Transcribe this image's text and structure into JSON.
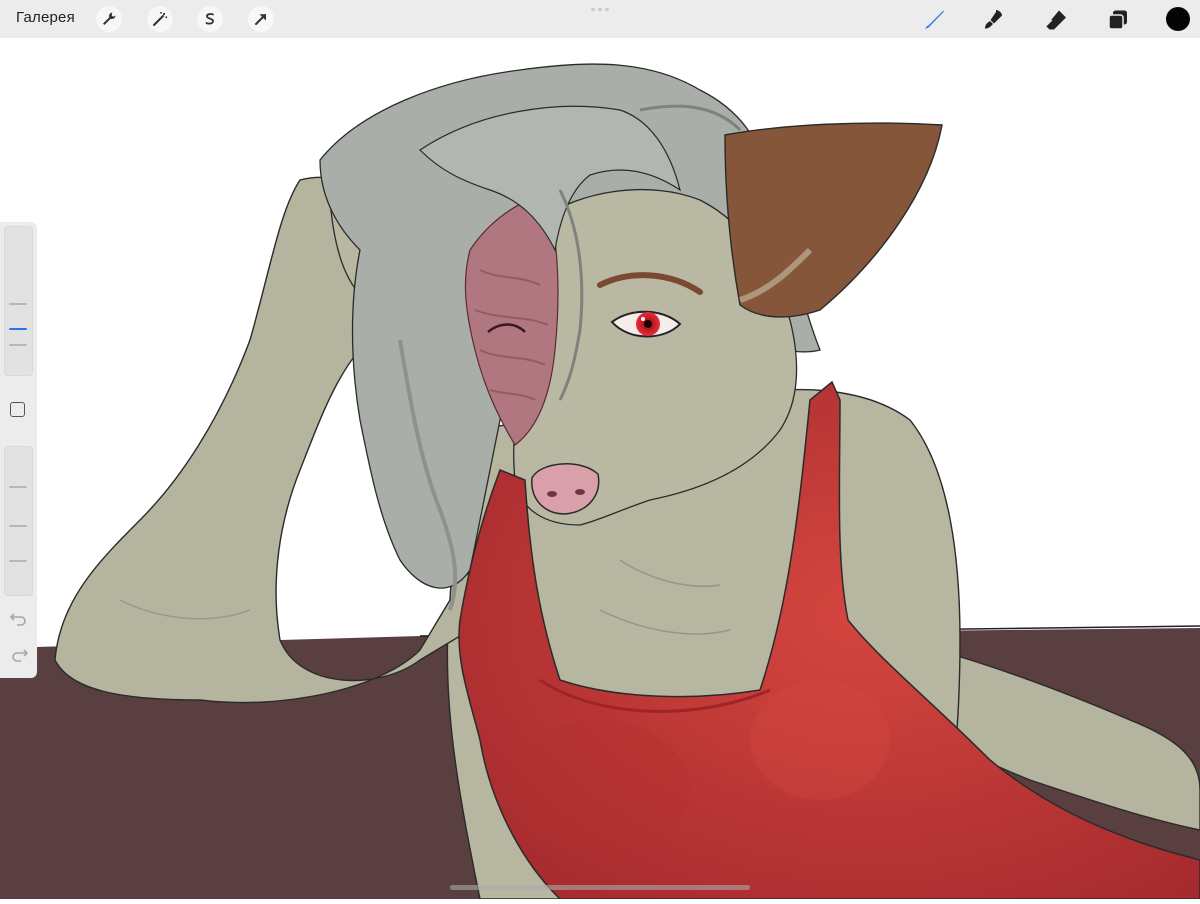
{
  "topbar": {
    "gallery_label": "Галерея",
    "left_tools": [
      {
        "icon": "wrench-icon"
      },
      {
        "icon": "magic-wand-icon"
      },
      {
        "icon": "selection-icon"
      },
      {
        "icon": "transform-arrow-icon"
      }
    ],
    "right_tools": [
      {
        "icon": "brush-icon",
        "active_color": "#1e7ae8"
      },
      {
        "icon": "smudge-icon"
      },
      {
        "icon": "eraser-icon"
      },
      {
        "icon": "layers-icon"
      }
    ],
    "current_color": "#050505"
  },
  "sidebar": {
    "brush_size_icon": "brush-size-slider",
    "opacity_icon": "opacity-slider",
    "modify_button_icon": "square-icon",
    "undo_icon": "undo-icon",
    "redo_icon": "redo-icon",
    "accent": "#1e7ae8"
  },
  "canvas": {
    "background": "#ffffff",
    "floor_color": "#5a3f40",
    "fur_color": "#b5b49e",
    "hair_color": "#a9aea8",
    "ear_color": "#85563a",
    "dress_color": "#c6383a",
    "eye_color": "#d21b23",
    "scar_color": "#b07780",
    "nose_color": "#d9a0aa"
  }
}
